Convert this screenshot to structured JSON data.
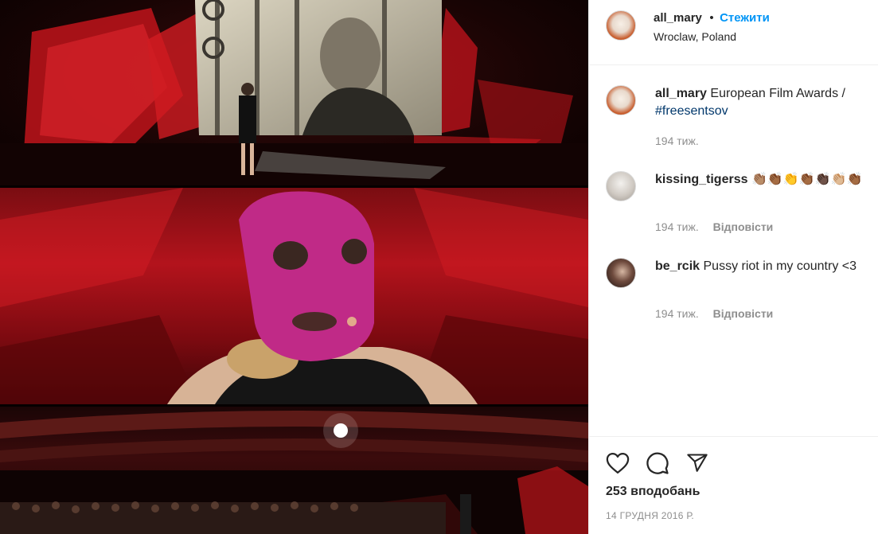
{
  "post": {
    "author": "all_mary",
    "dot": "•",
    "follow_label": "Стежити",
    "location": "Wroclaw, Poland",
    "caption": {
      "user": "all_mary",
      "text": "European Film Awards /",
      "hashtag": "#freesentsov",
      "time": "194 тиж."
    },
    "comments": [
      {
        "user": "kissing_tigerss",
        "text": "👏🏽👏🏾👏👏🏾👏🏿👏🏼👏🏾",
        "time": "194 тиж.",
        "reply": "Відповісти"
      },
      {
        "user": "be_rcik",
        "text": "Pussy riot in my country <3",
        "time": "194 тиж.",
        "reply": "Відповісти"
      }
    ],
    "likes": "253 вподобань",
    "date": "14 ГРУДНЯ 2016 Р."
  },
  "colors": {
    "link": "#0095f6",
    "hashtag": "#00376b",
    "muted": "#8e8e8e",
    "text": "#262626"
  },
  "icons": [
    "heart-icon",
    "comment-icon",
    "share-icon"
  ]
}
